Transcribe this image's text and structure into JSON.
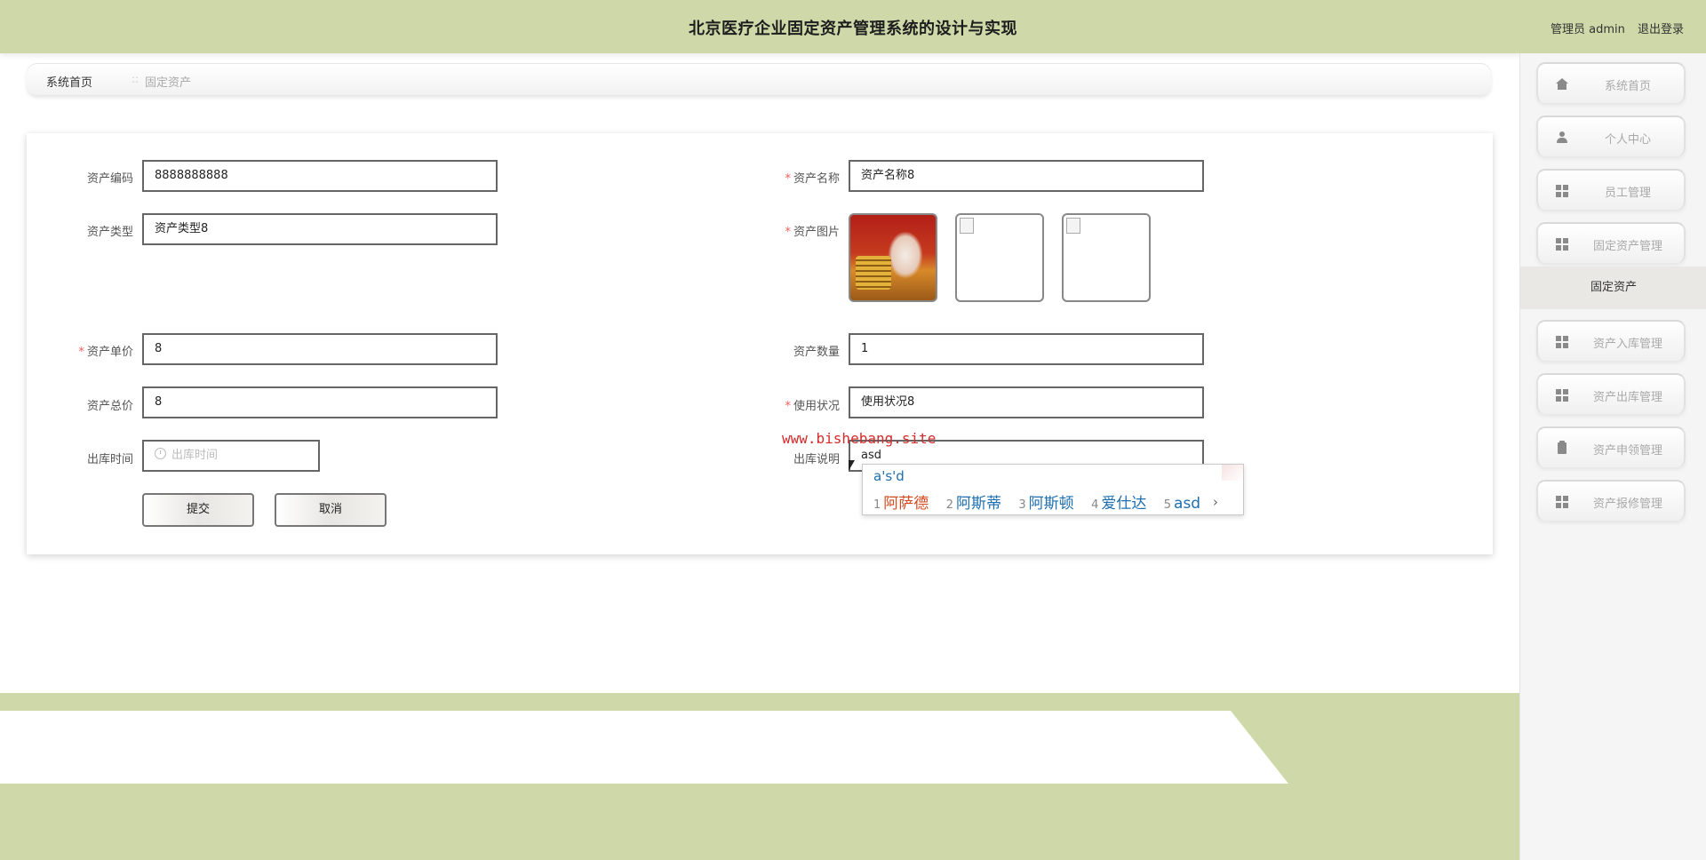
{
  "header": {
    "title": "北京医疗企业固定资产管理系统的设计与实现",
    "user_role": "管理员 admin",
    "logout_label": "退出登录"
  },
  "breadcrumb": {
    "home": "系统首页",
    "separator": "::",
    "current": "固定资产"
  },
  "form": {
    "asset_code": {
      "label": "资产编码",
      "value": "8888888888",
      "required": false
    },
    "asset_name": {
      "label": "资产名称",
      "value": "资产名称8",
      "required": true
    },
    "asset_type": {
      "label": "资产类型",
      "value": "资产类型8",
      "required": false
    },
    "asset_image": {
      "label": "资产图片",
      "required": true,
      "count": 3
    },
    "unit_price": {
      "label": "资产单价",
      "value": "8",
      "required": true
    },
    "quantity": {
      "label": "资产数量",
      "value": "1",
      "required": false
    },
    "total_price": {
      "label": "资产总价",
      "value": "8",
      "required": false
    },
    "usage_status": {
      "label": "使用状况",
      "value": "使用状况8",
      "required": true
    },
    "out_time": {
      "label": "出库时间",
      "placeholder": "出库时间",
      "required": false
    },
    "out_note": {
      "label": "出库说明",
      "value": "asd",
      "required": false
    },
    "required_mark": "*",
    "submit_label": "提交",
    "cancel_label": "取消"
  },
  "watermark": "www.bishebang.site",
  "ime": {
    "composition": "a's'd",
    "candidates": [
      {
        "num": "1",
        "text": "阿萨德"
      },
      {
        "num": "2",
        "text": "阿斯蒂"
      },
      {
        "num": "3",
        "text": "阿斯顿"
      },
      {
        "num": "4",
        "text": "爱仕达"
      },
      {
        "num": "5",
        "text": "asd"
      }
    ],
    "next": "›"
  },
  "sidebar": {
    "items": [
      {
        "label": "系统首页",
        "icon": "home-icon"
      },
      {
        "label": "个人中心",
        "icon": "user-icon"
      },
      {
        "label": "员工管理",
        "icon": "grid-icon"
      },
      {
        "label": "固定资产管理",
        "icon": "grid-icon"
      },
      {
        "label": "资产入库管理",
        "icon": "grid-icon"
      },
      {
        "label": "资产出库管理",
        "icon": "grid-icon"
      },
      {
        "label": "资产申领管理",
        "icon": "clipboard-icon"
      },
      {
        "label": "资产报修管理",
        "icon": "grid-icon"
      }
    ],
    "active_sub": "固定资产"
  },
  "colors": {
    "header_bg": "#cfd8a9",
    "required": "#ff5a5a",
    "watermark": "#d42b2b",
    "ime_highlight": "#d34b1f",
    "ime_text": "#1d6fb0"
  }
}
